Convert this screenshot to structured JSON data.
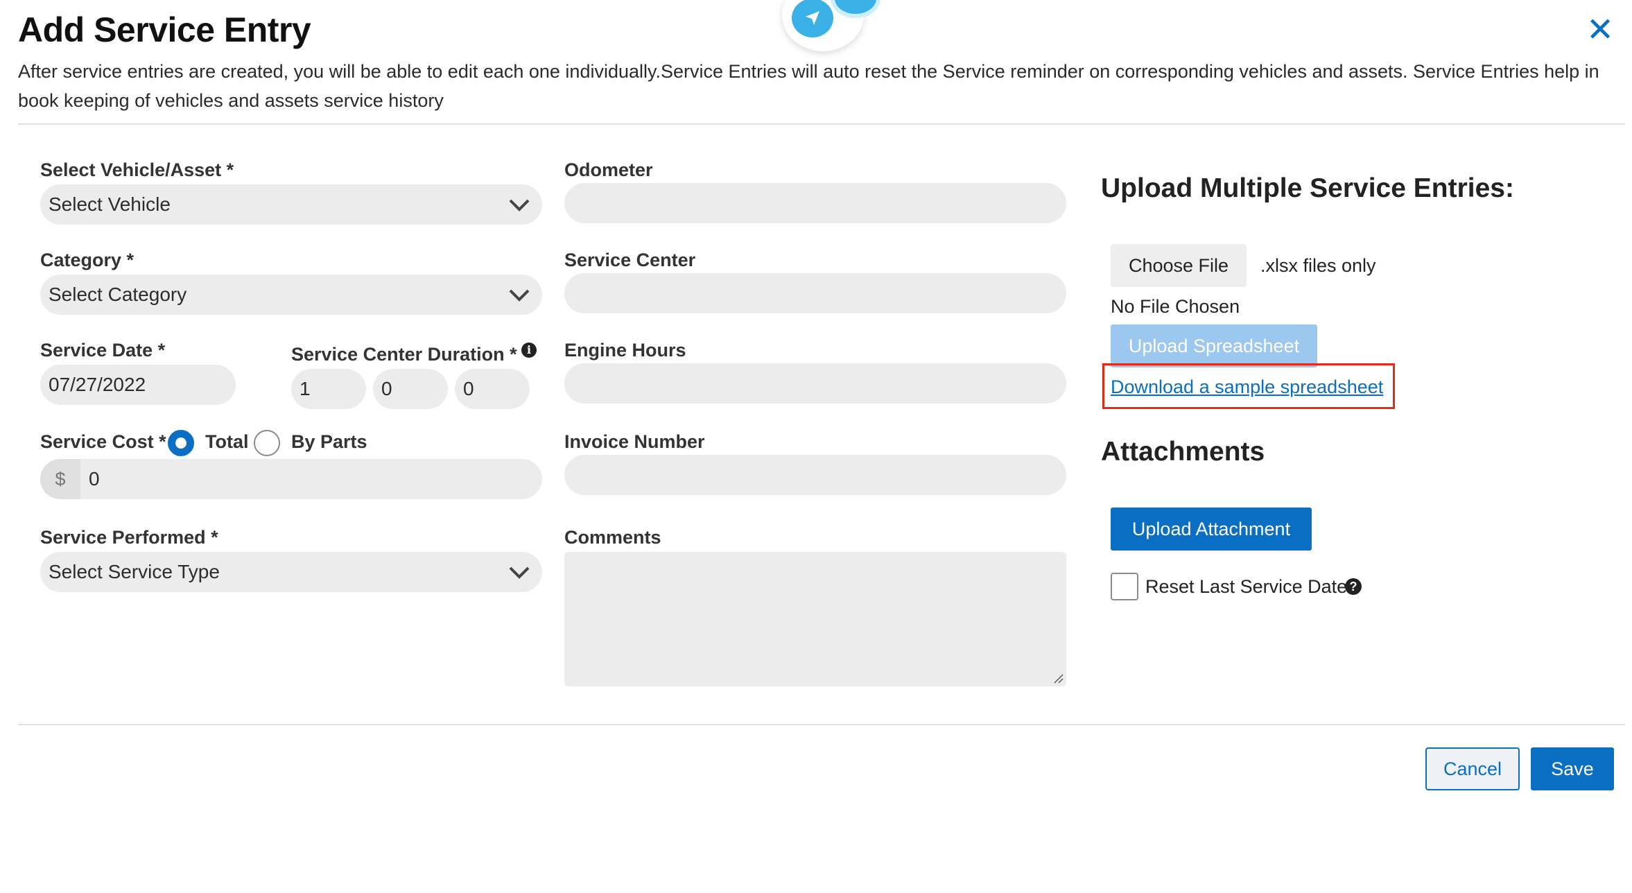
{
  "header": {
    "title": "Add Service Entry",
    "description": "After service entries are created, you will be able to edit each one individually.Service Entries will auto reset the Service reminder on corresponding vehicles and assets. Service Entries help in book keeping of vehicles and assets service history",
    "close_icon": "close-x-icon"
  },
  "form": {
    "vehicle": {
      "label": "Select Vehicle/Asset *",
      "value": "Select Vehicle"
    },
    "category": {
      "label": "Category *",
      "value": "Select Category"
    },
    "service_date": {
      "label": "Service Date *",
      "value": "07/27/2022"
    },
    "duration": {
      "label": "Service Center Duration *",
      "values": [
        "1",
        "0",
        "0"
      ]
    },
    "service_cost": {
      "label": "Service Cost *",
      "options": [
        "Total",
        "By Parts"
      ],
      "selected": "Total",
      "currency": "$",
      "value": "0"
    },
    "service_performed": {
      "label": "Service Performed *",
      "value": "Select Service Type"
    },
    "odometer": {
      "label": "Odometer",
      "value": ""
    },
    "service_center": {
      "label": "Service Center",
      "value": ""
    },
    "engine_hours": {
      "label": "Engine Hours",
      "value": ""
    },
    "invoice_number": {
      "label": "Invoice Number",
      "value": ""
    },
    "comments": {
      "label": "Comments",
      "value": ""
    }
  },
  "upload": {
    "heading": "Upload Multiple Service Entries:",
    "choose_file": "Choose File",
    "file_hint": ".xlsx files only",
    "no_file": "No File Chosen",
    "upload_spreadsheet": "Upload Spreadsheet",
    "download_sample": "Download a sample spreadsheet"
  },
  "attachments": {
    "heading": "Attachments",
    "upload_button": "Upload Attachment",
    "reset_label": "Reset Last Service Date",
    "reset_checked": false
  },
  "footer": {
    "cancel": "Cancel",
    "save": "Save"
  },
  "colors": {
    "primary": "#0a6fc2",
    "disabled_button": "#9cc7ee",
    "field_bg": "#ececec",
    "highlight_box": "#e22b14"
  }
}
